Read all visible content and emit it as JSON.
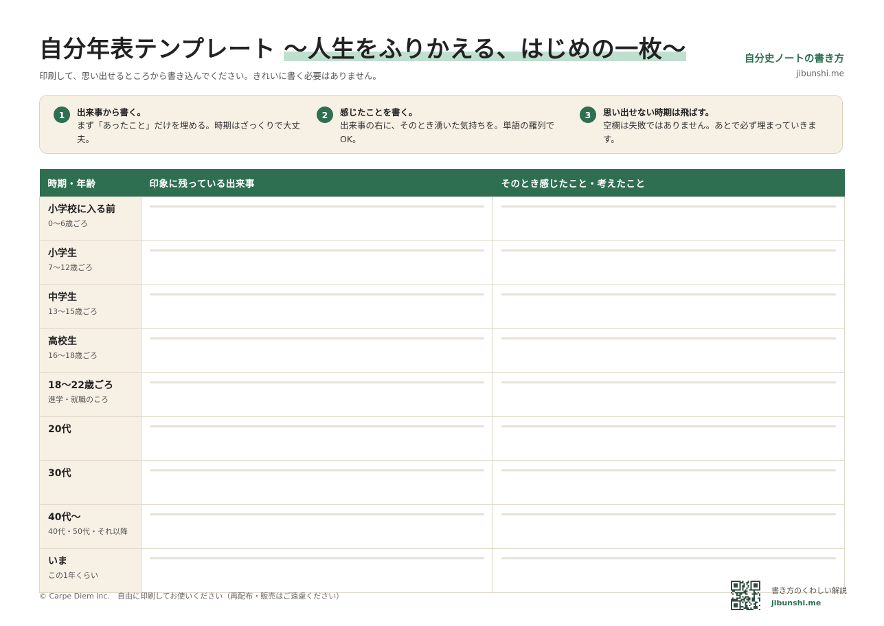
{
  "header": {
    "title_main": "自分年表テンプレート ",
    "title_highlight": "〜人生をふりかえる、はじめの一枚〜",
    "subtitle": "印刷して、思い出せるところから書き込んでください。きれいに書く必要はありません。"
  },
  "brand": {
    "title": "自分史ノートの書き方",
    "url": "jibunshi.me"
  },
  "steps": [
    {
      "num": "1",
      "title": "出来事から書く。",
      "desc": "まず「あったこと」だけを埋める。時期はざっくりで大丈夫。"
    },
    {
      "num": "2",
      "title": "感じたことを書く。",
      "desc": "出来事の右に、そのとき湧いた気持ちを。単語の羅列でOK。"
    },
    {
      "num": "3",
      "title": "思い出せない時期は飛ばす。",
      "desc": "空欄は失敗ではありません。あとで必ず埋まっていきます。"
    }
  ],
  "table": {
    "headers": [
      "時期・年齢",
      "印象に残っている出来事",
      "そのとき感じたこと・考えたこと"
    ],
    "rows": [
      {
        "label": "小学校に入る前",
        "sub": "0〜6歳ごろ"
      },
      {
        "label": "小学生",
        "sub": "7〜12歳ごろ"
      },
      {
        "label": "中学生",
        "sub": "13〜15歳ごろ"
      },
      {
        "label": "高校生",
        "sub": "16〜18歳ごろ"
      },
      {
        "label": "18〜22歳ごろ",
        "sub": "進学・就職のころ"
      },
      {
        "label": "20代",
        "sub": ""
      },
      {
        "label": "30代",
        "sub": ""
      },
      {
        "label": "40代〜",
        "sub": "40代・50代・それ以降"
      },
      {
        "label": "いま",
        "sub": "この1年くらい"
      }
    ]
  },
  "footer": {
    "copyright": "© Carpe Diem Inc.　自由に印刷してお使いください（再配布・販売はご遠慮ください）",
    "note": "書き方のくわしい解説",
    "url": "jibunshi.me"
  },
  "colors": {
    "accent": "#2e6f52",
    "highlight": "#bfe0cf",
    "panel": "#f7f0e5"
  },
  "icons": {
    "qr": "qr-code-icon"
  }
}
